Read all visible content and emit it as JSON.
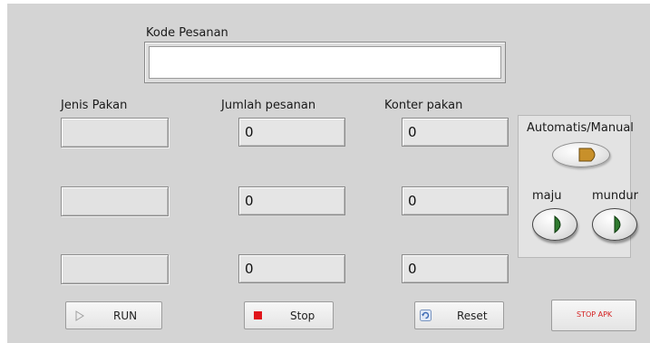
{
  "labels": {
    "kode_pesanan": "Kode Pesanan",
    "jenis_pakan": "Jenis Pakan",
    "jumlah_pesanan": "Jumlah pesanan",
    "konter_pakan": "Konter pakan",
    "automatis_manual": "Automatis/Manual",
    "maju": "maju",
    "mundur": "mundur"
  },
  "kode_pesanan_value": "",
  "jenis_pakan": [
    "",
    "",
    ""
  ],
  "jumlah_pesanan": [
    "0",
    "0",
    "0"
  ],
  "konter_pakan": [
    "0",
    "0",
    "0"
  ],
  "buttons": {
    "run": "RUN",
    "stop": "Stop",
    "reset": "Reset",
    "stop_apk": "STOP APK"
  },
  "colors": {
    "panel_bg": "#d4d4d4",
    "toggle_led": "#c8902a",
    "direction_led": "#2f7a2f",
    "stop_square": "#e0141a",
    "stop_apk_text": "#d42020"
  },
  "icons": {
    "run": "play-outline-icon",
    "stop": "stop-square-icon",
    "reset": "refresh-icon"
  }
}
